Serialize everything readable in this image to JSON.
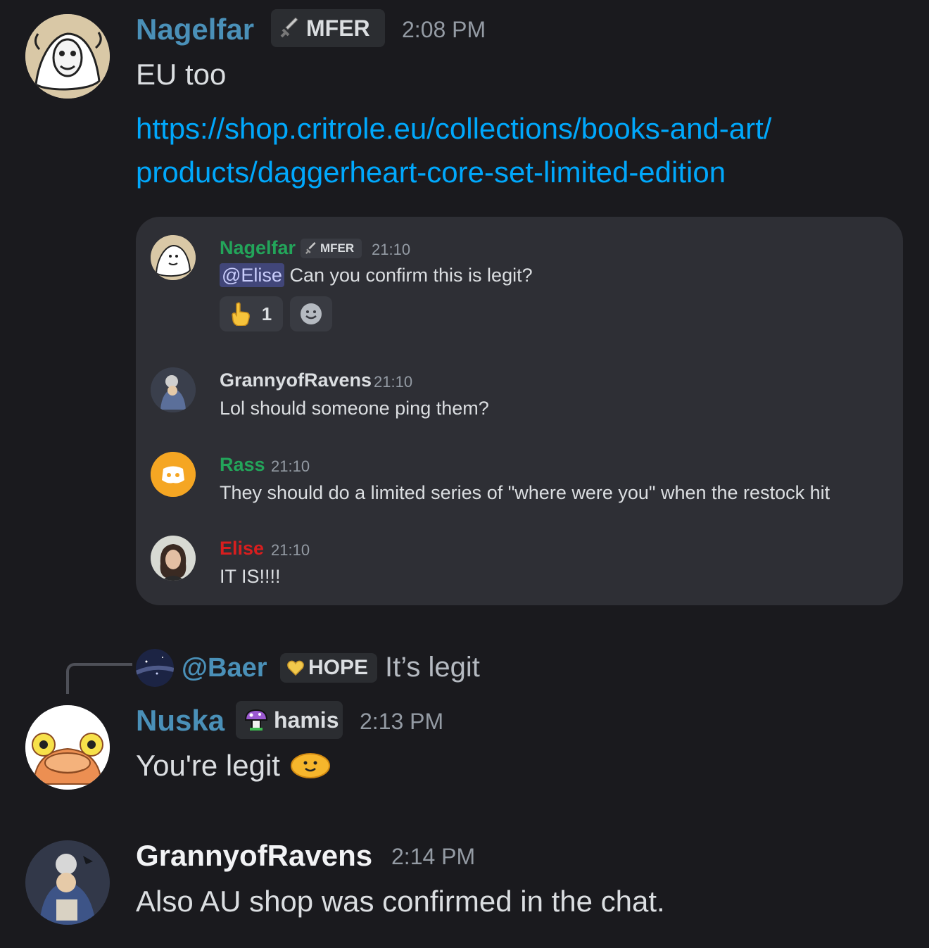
{
  "messages": {
    "m1": {
      "author": "Nagelfar",
      "author_color": "#4a90b8",
      "role_tag": "MFER",
      "timestamp": "2:08 PM",
      "text": "EU too",
      "link_line1": "https://shop.critrole.eu/collections/books-and-art/",
      "link_line2": "products/daggerheart-core-set-limited-edition"
    },
    "embed": {
      "e1": {
        "author": "Nagelfar",
        "author_color": "#23a55a",
        "role_tag": "MFER",
        "timestamp": "21:10",
        "mention": "@Elise",
        "text": "Can you confirm this is legit?",
        "reaction_count": "1",
        "reaction_icon": "pointing-hand-icon",
        "add_reaction_icon": "smiley-icon"
      },
      "e2": {
        "author": "GrannyofRavens",
        "author_color": "#dbdee1",
        "timestamp": "21:10",
        "text": "Lol should someone ping them?"
      },
      "e3": {
        "author": "Rass",
        "author_color": "#23a55a",
        "timestamp": "21:10",
        "text": "They should do a limited series of \"where were you\" when the restock hit"
      },
      "e4": {
        "author": "Elise",
        "author_color": "#d81e1e",
        "timestamp": "21:10",
        "text": "IT IS!!!!"
      }
    },
    "reply": {
      "mention": "@Baer",
      "role_tag": "HOPE",
      "text": "It’s legit"
    },
    "m2": {
      "author": "Nuska",
      "author_color": "#4a90b8",
      "role_tag": "hamis",
      "timestamp": "2:13 PM",
      "text": "You're legit"
    },
    "m3": {
      "author": "GrannyofRavens",
      "author_color": "#f2f3f5",
      "timestamp": "2:14 PM",
      "text": "Also AU shop was confirmed in the chat."
    }
  }
}
